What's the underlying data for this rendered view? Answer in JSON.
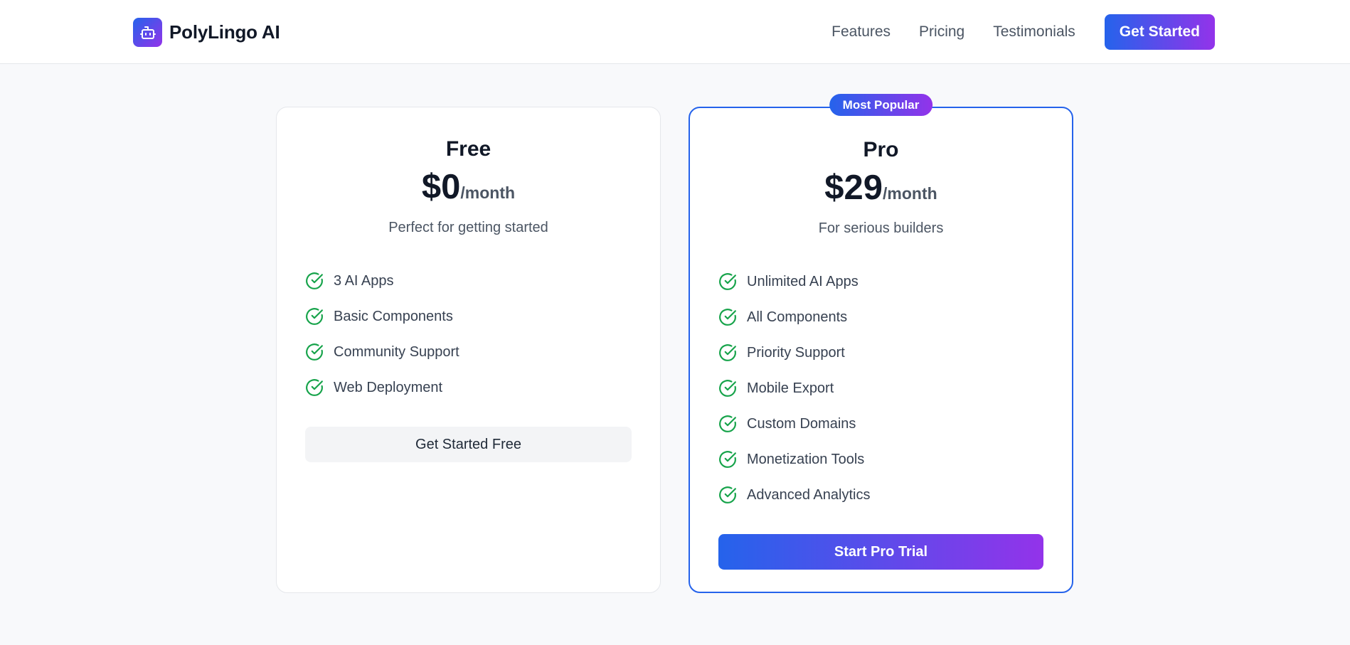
{
  "app": {
    "brand": "PolyLingo AI"
  },
  "nav": {
    "links": [
      "Features",
      "Pricing",
      "Testimonials"
    ],
    "cta": "Get Started"
  },
  "plans": [
    {
      "name": "Free",
      "price": "$0",
      "period": "/month",
      "tagline": "Perfect for getting started",
      "features": [
        "3 AI Apps",
        "Basic Components",
        "Community Support",
        "Web Deployment"
      ],
      "cta": "Get Started Free"
    },
    {
      "name": "Pro",
      "badge": "Most Popular",
      "price": "$29",
      "period": "/month",
      "tagline": "For serious builders",
      "features": [
        "Unlimited AI Apps",
        "All Components",
        "Priority Support",
        "Mobile Export",
        "Custom Domains",
        "Monetization Tools",
        "Advanced Analytics"
      ],
      "cta": "Start Pro Trial"
    }
  ],
  "colors": {
    "accent_start": "#2563eb",
    "accent_end": "#9333ea",
    "check": "#16a34a"
  },
  "icons": {
    "logo": "robot-icon",
    "feature": "check-circle-icon"
  }
}
